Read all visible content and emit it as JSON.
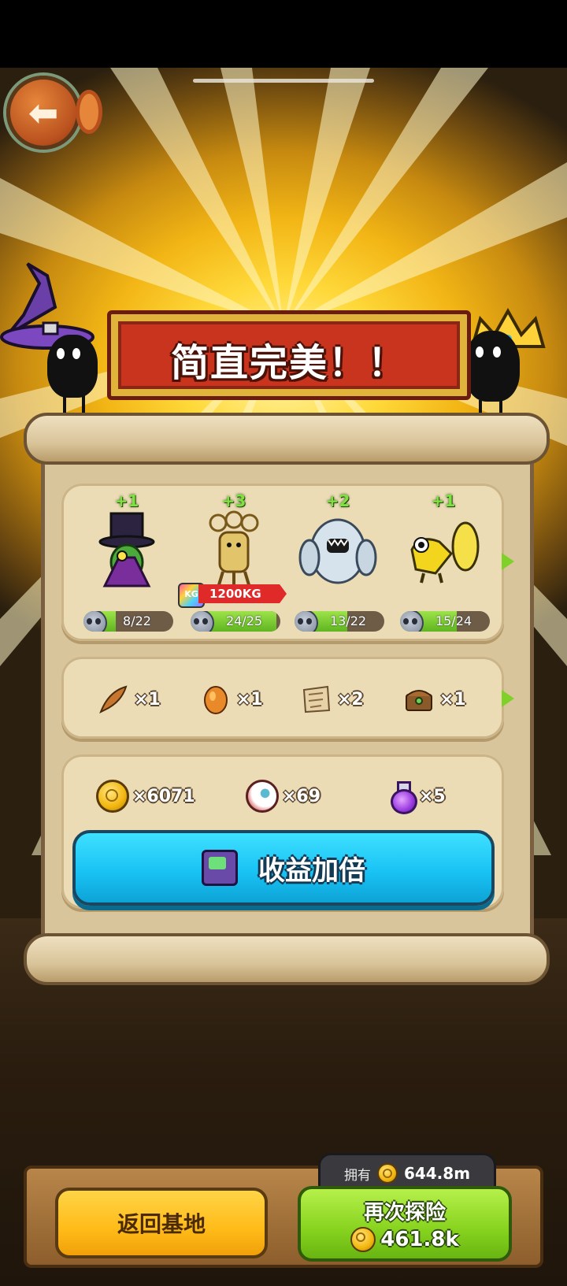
{
  "banner": {
    "title": "简直完美！！"
  },
  "monsters": [
    {
      "name_icon": "wizard-cactus-monster",
      "bonus": "+1",
      "progress_text": "8/22",
      "progress": 0.36
    },
    {
      "name_icon": "golden-tree-monster",
      "bonus": "+3",
      "progress_text": "24/25",
      "progress": 0.96,
      "weight": "1200KG",
      "weight_badge": "KG"
    },
    {
      "name_icon": "yeti-monster",
      "bonus": "+2",
      "progress_text": "13/22",
      "progress": 0.59
    },
    {
      "name_icon": "yellow-lizard-monster",
      "bonus": "+1",
      "progress_text": "15/24",
      "progress": 0.63
    }
  ],
  "items": [
    {
      "icon": "feather-icon",
      "qty": "×1"
    },
    {
      "icon": "amber-egg-icon",
      "qty": "×1"
    },
    {
      "icon": "map-scroll-icon",
      "qty": "×2"
    },
    {
      "icon": "treasure-chest-icon",
      "qty": "×1"
    }
  ],
  "currency": [
    {
      "icon": "gold-coin-icon",
      "qty": "×6071"
    },
    {
      "icon": "eyeball-icon",
      "qty": "×69"
    },
    {
      "icon": "potion-icon",
      "qty": "×5"
    }
  ],
  "double_button": {
    "label": "收益加倍"
  },
  "bottom": {
    "return_label": "返回基地",
    "own_label": "拥有",
    "own_value": "644.8m",
    "again_label": "再次探险",
    "again_cost": "461.8k"
  },
  "colors": {
    "banner": "#c8341e",
    "double_button": "#19c3f4",
    "again_button": "#86d21e",
    "return_button": "#ffbb18",
    "progress_fill": "#7fd12a"
  }
}
